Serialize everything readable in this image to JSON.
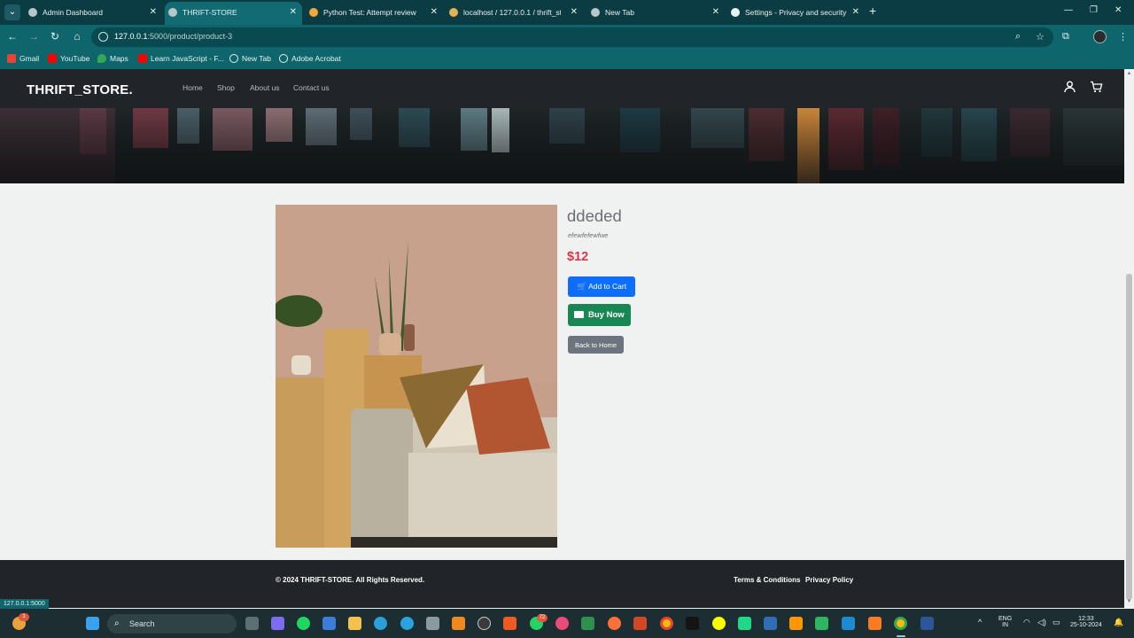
{
  "browser": {
    "tabs": [
      {
        "title": "Admin Dashboard"
      },
      {
        "title": "THRIFT-STORE"
      },
      {
        "title": "Python Test: Attempt review"
      },
      {
        "title": "localhost / 127.0.0.1 / thrift_sto"
      },
      {
        "title": "New Tab"
      },
      {
        "title": "Settings - Privacy and security"
      }
    ],
    "url_host": "127.0.0.1",
    "url_path": ":5000/product/product-3",
    "bookmarks": [
      "Gmail",
      "YouTube",
      "Maps",
      "Learn JavaScript - F...",
      "New Tab",
      "Adobe Acrobat"
    ],
    "status_url": "127.0.0.1:5000"
  },
  "navbar": {
    "brand": "THRIFT_STORE.",
    "links": [
      "Home",
      "Shop",
      "About us",
      "Contact us"
    ]
  },
  "product": {
    "name": "ddeded",
    "description": "efewfefewfwe",
    "price": "$12",
    "add_to_cart": "Add to Cart",
    "buy_now": "Buy Now",
    "back_home": "Back to Home"
  },
  "footer": {
    "copyright": "© 2024 THRIFT-STORE. All Rights Reserved.",
    "terms": "Terms & Conditions",
    "privacy": "Privacy Policy"
  },
  "taskbar": {
    "search": "Search",
    "lang_top": "ENG",
    "lang_bottom": "IN",
    "time": "12:33",
    "date": "25-10-2024",
    "whatsapp_badge": "72",
    "widget_badge": "1"
  },
  "colors": {
    "accent_primary": "#0d6efd",
    "accent_success": "#198754",
    "accent_secondary": "#6c757d",
    "price": "#dc3545",
    "navbar": "#212529",
    "chrome": "#0e666c"
  }
}
